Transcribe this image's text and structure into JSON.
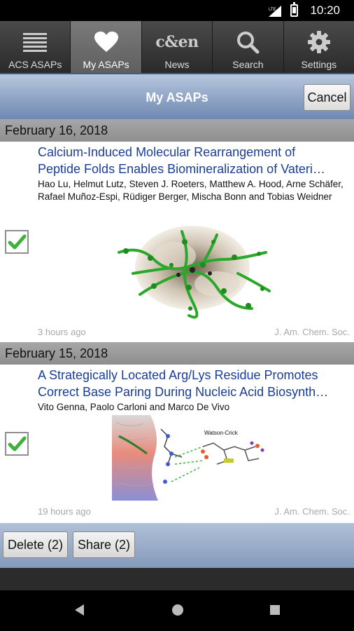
{
  "status_bar": {
    "time": "10:20",
    "network": "LTE"
  },
  "tabs": [
    {
      "label": "ACS ASAPs",
      "icon": "list-icon",
      "active": false
    },
    {
      "label": "My ASAPs",
      "icon": "heart-icon",
      "active": true
    },
    {
      "label": "News",
      "icon": "cen-logo-icon",
      "logo_text": "c&en",
      "active": false
    },
    {
      "label": "Search",
      "icon": "search-icon",
      "active": false
    },
    {
      "label": "Settings",
      "icon": "gear-icon",
      "active": false
    }
  ],
  "header": {
    "title": "My ASAPs",
    "cancel_label": "Cancel"
  },
  "sections": [
    {
      "date": "February 16, 2018",
      "items": [
        {
          "title_line1": "Calcium-Induced Molecular Rearrangement of",
          "title_line2": "Peptide Folds Enables Biomineralization of Vateri…",
          "authors": "Hao Lu, Helmut Lutz, Steven J. Roeters, Matthew A. Hood, Arne Schäfer, Rafael Muñoz-Espi, Rüdiger Berger, Mischa Bonn and Tobias Weidner",
          "time_ago": "3 hours ago",
          "journal": "J. Am. Chem. Soc.",
          "checked": true
        }
      ]
    },
    {
      "date": "February 15, 2018",
      "items": [
        {
          "title_line1": "A Strategically Located Arg/Lys Residue Promotes",
          "title_line2": "Correct Base Paring During Nucleic Acid Biosynth…",
          "authors": "Vito Genna, Paolo Carloni and Marco De Vivo",
          "figure_label": "Watson-Crick",
          "time_ago": "19 hours ago",
          "journal": "J. Am. Chem. Soc.",
          "checked": true
        }
      ]
    }
  ],
  "actions": {
    "delete_label": "Delete (2)",
    "share_label": "Share (2)"
  },
  "colors": {
    "link": "#1a3d97",
    "check": "#3fb13a",
    "header_gradient_top": "#b6c6dd",
    "header_gradient_bottom": "#6f89b2"
  }
}
